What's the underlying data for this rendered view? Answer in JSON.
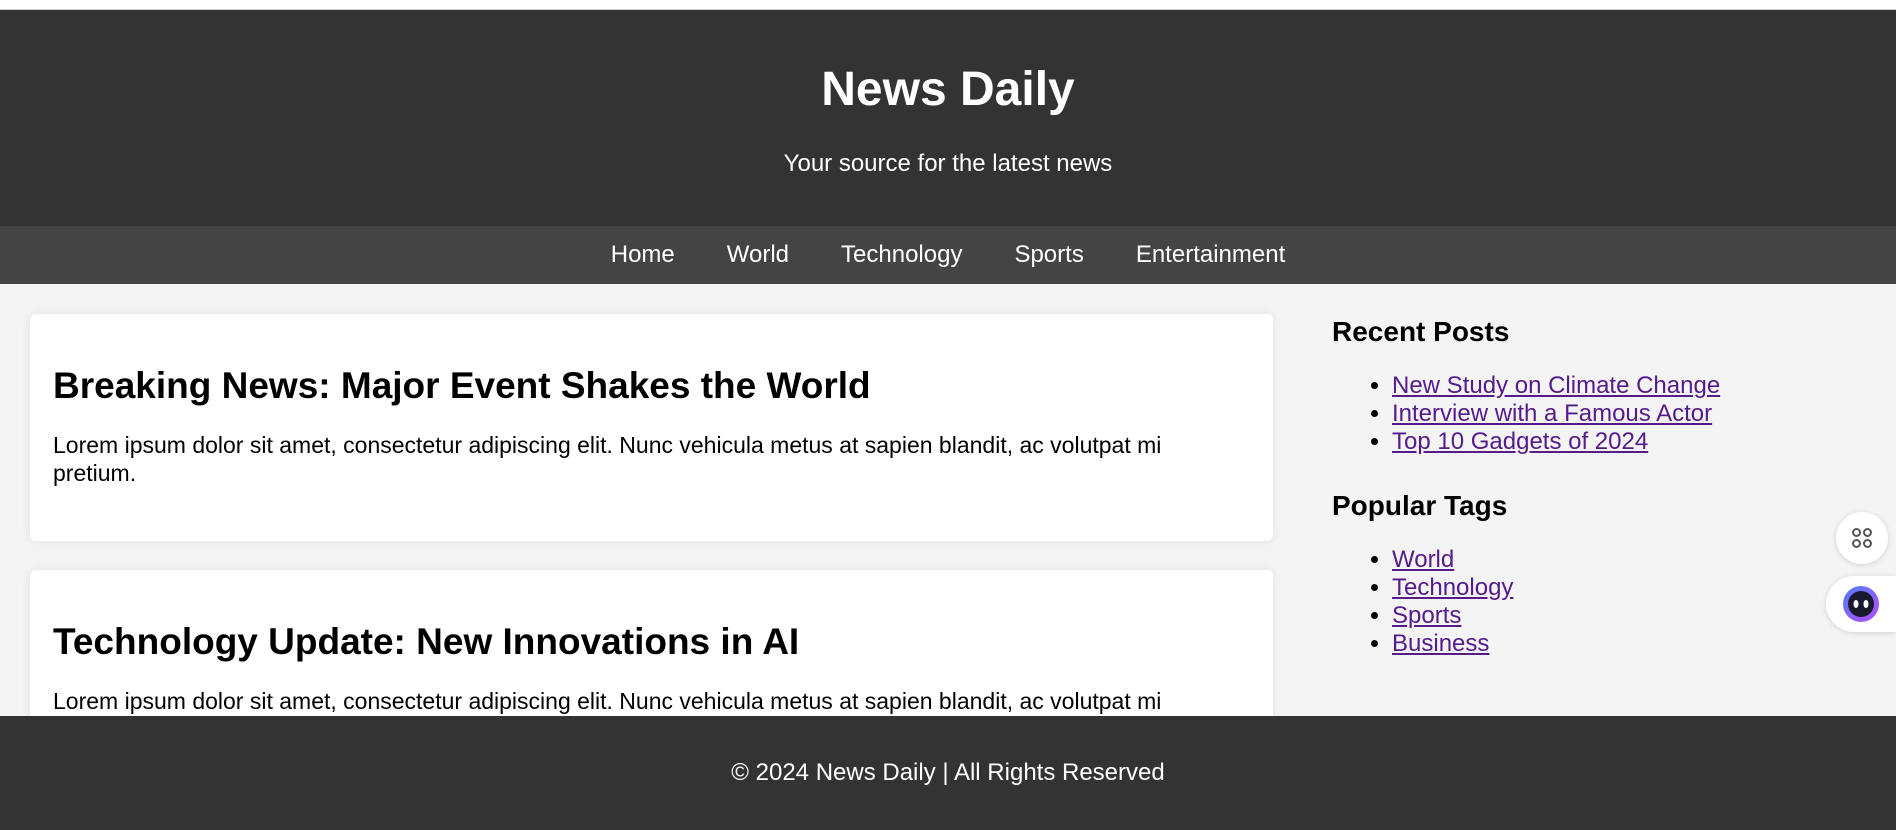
{
  "header": {
    "title": "News Daily",
    "subtitle": "Your source for the latest news"
  },
  "nav": {
    "items": [
      {
        "label": "Home"
      },
      {
        "label": "World"
      },
      {
        "label": "Technology"
      },
      {
        "label": "Sports"
      },
      {
        "label": "Entertainment"
      }
    ]
  },
  "articles": [
    {
      "title": "Breaking News: Major Event Shakes the World",
      "body": "Lorem ipsum dolor sit amet, consectetur adipiscing elit. Nunc vehicula metus at sapien blandit, ac volutpat mi pretium."
    },
    {
      "title": "Technology Update: New Innovations in AI",
      "body": "Lorem ipsum dolor sit amet, consectetur adipiscing elit. Nunc vehicula metus at sapien blandit, ac volutpat mi pretium."
    }
  ],
  "sidebar": {
    "recent_heading": "Recent Posts",
    "recent": [
      {
        "label": "New Study on Climate Change"
      },
      {
        "label": "Interview with a Famous Actor"
      },
      {
        "label": "Top 10 Gadgets of 2024"
      }
    ],
    "tags_heading": "Popular Tags",
    "tags": [
      {
        "label": "World"
      },
      {
        "label": "Technology"
      },
      {
        "label": "Sports"
      },
      {
        "label": "Business"
      }
    ]
  },
  "footer": {
    "copyright": "© 2024 News Daily | All Rights Reserved"
  },
  "floating": {
    "shortcut_icon": "command-key-icon",
    "assistant_icon": "assistant-face-icon"
  },
  "colors": {
    "header_bg": "#333333",
    "nav_bg": "#444444",
    "page_bg": "#f4f4f4",
    "visited_link": "#551a8b"
  }
}
